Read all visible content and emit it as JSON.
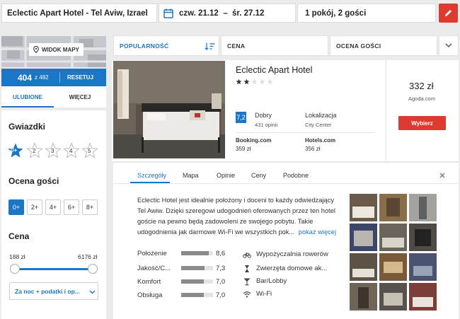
{
  "search": {
    "destination": "Eclectic Apart Hotel - Tel Aviw, Izrael",
    "dates": "czw. 21.12  –  śr. 27.12",
    "guests": "1 pokój, 2 gości"
  },
  "icons": [
    "calendar-icon",
    "pencil-icon",
    "map-pin-icon",
    "sort-icon",
    "chevron-down-icon",
    "close-icon",
    "bicycle-icon",
    "hourglass-icon",
    "cocktail-icon",
    "wifi-icon"
  ],
  "sidebar": {
    "map_label": "WIDOK MAPY",
    "count": "404",
    "count_of": "z 482",
    "reset_label": "RESETUJ",
    "tabs": [
      {
        "label": "ULUBIONE"
      },
      {
        "label": "WIĘCEJ"
      }
    ],
    "stars_title": "Gwiazdki",
    "star_options": [
      "0+",
      "2",
      "3",
      "4",
      "5"
    ],
    "rating_title": "Ocena gości",
    "rating_options": [
      "0+",
      "2+",
      "4+",
      "6+",
      "8+"
    ],
    "price_title": "Cena",
    "price_min": "188 zł",
    "price_max": "6176 zł",
    "price_mode": "Za noc + podatki i op..."
  },
  "sort": {
    "popularity": "POPULARNOŚĆ",
    "price": "CENA",
    "rating": "OCENA GOŚCI"
  },
  "hotel": {
    "name": "Eclectic Apart Hotel",
    "stars": 2,
    "score": "7,2",
    "score_label": "Dobry",
    "reviews": "431 opinii",
    "location_label": "Lokalizacja",
    "location_value": "City Center",
    "offers": [
      {
        "site": "Booking.com",
        "price": "359 zł"
      },
      {
        "site": "Hotels.com",
        "price": "356 zł"
      }
    ],
    "best_price": "332 zł",
    "best_site": "Agoda.com",
    "choose_label": "Wybierz"
  },
  "details": {
    "tabs": [
      "Szczegóły",
      "Mapa",
      "Opinie",
      "Ceny",
      "Podobne"
    ],
    "description": "Eclectic Hotel jest idealnie położony i doceni to każdy odwiedzający Tel Awiw. Dzięki szeregowi udogodnień oferowanych przez ten hotel goście na pewno będą zadowoleni ze swojego pobytu. Takie udogodnienia jak darmowe Wi-Fi we wszystkich pok...",
    "more_label": "pokaż więcej",
    "ratings": [
      {
        "label": "Położenie",
        "value": "8,6",
        "level": 0.86
      },
      {
        "label": "Jakość/C...",
        "value": "7,3",
        "level": 0.73
      },
      {
        "label": "Komfort",
        "value": "7,0",
        "level": 0.7
      },
      {
        "label": "Obsługa",
        "value": "7,0",
        "level": 0.7
      }
    ],
    "amenities": [
      "Wypożyczalnia rowerów",
      "Zwierzęta domowe ak...",
      "Bar/Lobby",
      "Wi-Fi"
    ]
  },
  "colors": {
    "accent": "#1b76c6",
    "cta": "#dd3b2f"
  }
}
